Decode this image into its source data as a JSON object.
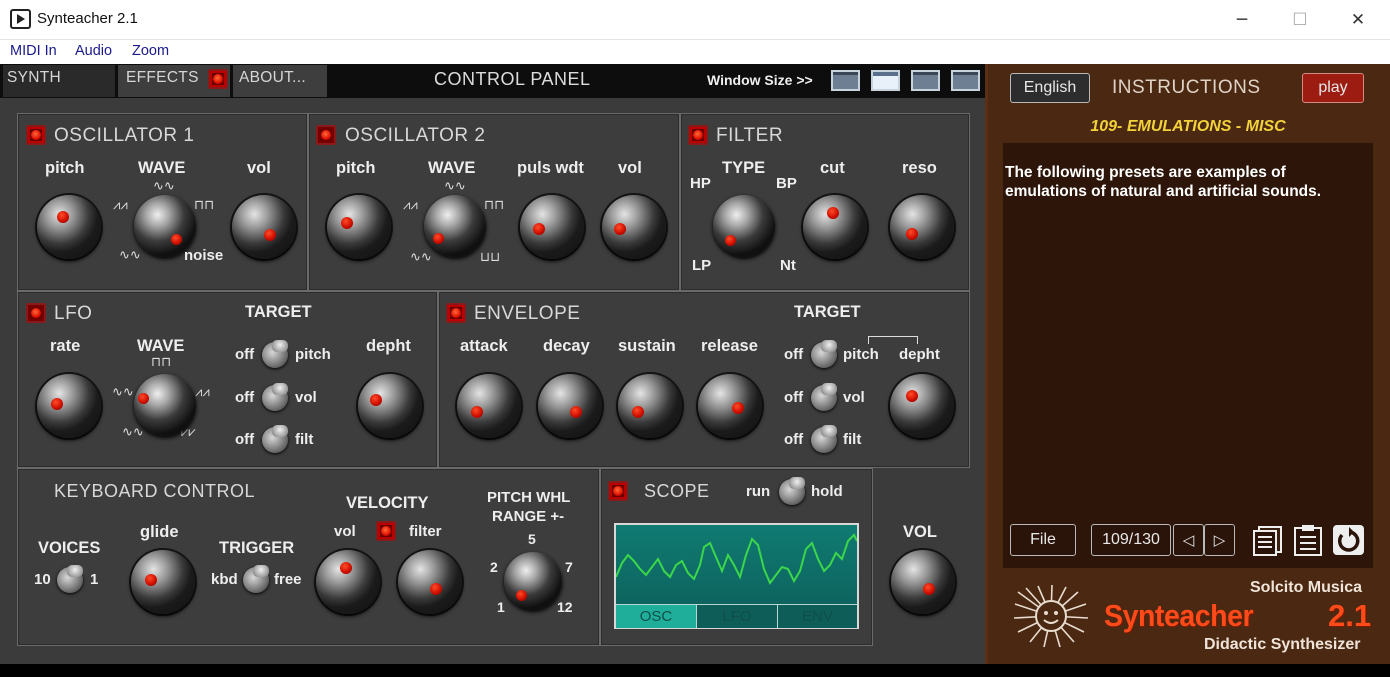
{
  "window": {
    "title": "Synteacher 2.1",
    "minimize": "─",
    "maximize": "☐",
    "close": "✕"
  },
  "menu": [
    "MIDI In",
    "Audio",
    "Zoom"
  ],
  "tabs": {
    "synth": "SYNTH",
    "effects": "EFFECTS",
    "about": "ABOUT..."
  },
  "header": {
    "title": "CONTROL PANEL",
    "window_size": "Window Size >>"
  },
  "osc1": {
    "title": "OSCILLATOR 1",
    "pitch": "pitch",
    "wave": "WAVE",
    "vol": "vol",
    "noise": "noise"
  },
  "osc2": {
    "title": "OSCILLATOR 2",
    "pitch": "pitch",
    "wave": "WAVE",
    "puls": "puls wdt",
    "vol": "vol"
  },
  "filter": {
    "title": "FILTER",
    "type": "TYPE",
    "cut": "cut",
    "reso": "reso",
    "hp": "HP",
    "bp": "BP",
    "lp": "LP",
    "nt": "Nt"
  },
  "lfo": {
    "title": "LFO",
    "rate": "rate",
    "wave": "WAVE",
    "target": "TARGET",
    "depht": "depht",
    "off": "off",
    "pitch": "pitch",
    "vol": "vol",
    "filt": "filt"
  },
  "envelope": {
    "title": "ENVELOPE",
    "attack": "attack",
    "decay": "decay",
    "sustain": "sustain",
    "release": "release",
    "target": "TARGET",
    "depht": "depht",
    "off": "off",
    "pitch": "pitch",
    "vol": "vol",
    "filt": "filt"
  },
  "keyboard": {
    "title": "KEYBOARD CONTROL",
    "voices": "VOICES",
    "v10": "10",
    "v1": "1",
    "glide": "glide",
    "trigger": "TRIGGER",
    "kbd": "kbd",
    "free": "free",
    "velocity": "VELOCITY",
    "vel_vol": "vol",
    "vel_filter": "filter",
    "pitchwhl": "PITCH WHL",
    "range": "RANGE +-",
    "r5": "5",
    "r2": "2",
    "r7": "7",
    "r1": "1",
    "r12": "12"
  },
  "scope": {
    "title": "SCOPE",
    "run": "run",
    "hold": "hold",
    "tabs": [
      "OSC",
      "LFO",
      "ENV"
    ]
  },
  "master": {
    "vol": "VOL"
  },
  "instructions": {
    "language": "English",
    "title": "INSTRUCTIONS",
    "play": "play",
    "preset": "109- EMULATIONS - MISC",
    "text": "The following presets are examples of emulations of natural and artificial sounds.",
    "file": "File",
    "counter": "109/130",
    "prev": "◁",
    "next": "▷"
  },
  "brand": {
    "company": "Solcito Musica",
    "name": "Synteacher",
    "version": "2.1",
    "tagline": "Didactic Synthesizer"
  }
}
